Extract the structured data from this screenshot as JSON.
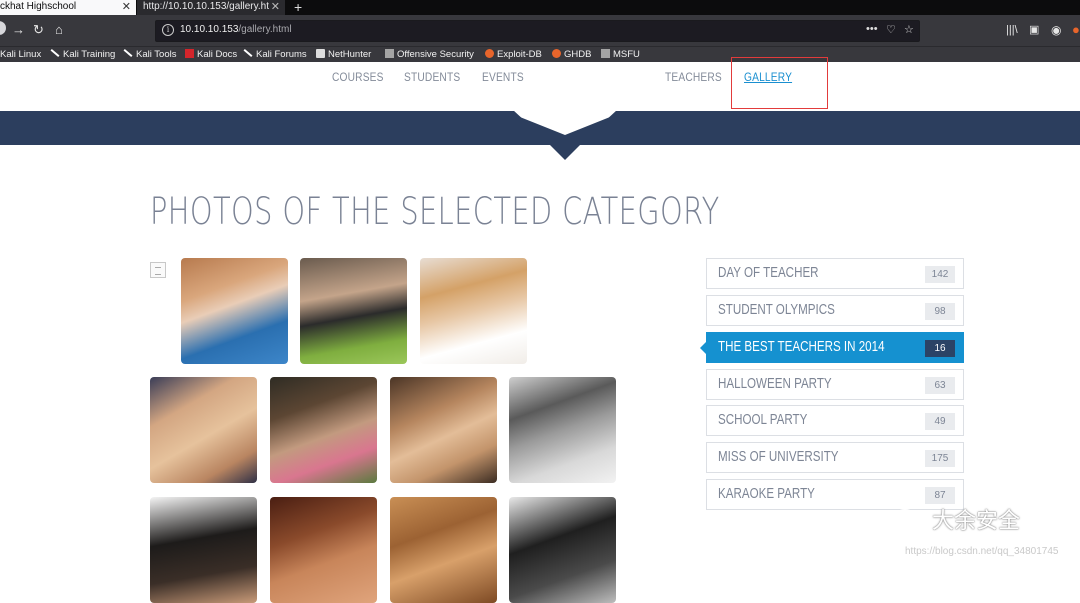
{
  "browser": {
    "tabs": [
      {
        "title": "ckhat Highschool",
        "close": "✕"
      },
      {
        "title": "http://10.10.10.153/gallery.ht",
        "close": "✕"
      }
    ],
    "new_tab": "+",
    "address": {
      "host": "10.10.10.153",
      "path": "/gallery.html"
    },
    "bookmarks": [
      {
        "label": "Kali Linux",
        "icon": "kali-dragon-icon"
      },
      {
        "label": "Kali Training",
        "icon": "kali-dragon-icon"
      },
      {
        "label": "Kali Tools",
        "icon": "kali-dragon-icon"
      },
      {
        "label": "Kali Docs",
        "icon": "kali-docs-icon"
      },
      {
        "label": "Kali Forums",
        "icon": "kali-dragon-icon"
      },
      {
        "label": "NetHunter",
        "icon": "nethunter-icon"
      },
      {
        "label": "Offensive Security",
        "icon": "offsec-icon"
      },
      {
        "label": "Exploit-DB",
        "icon": "exploitdb-icon"
      },
      {
        "label": "GHDB",
        "icon": "ghdb-icon"
      },
      {
        "label": "MSFU",
        "icon": "msfu-icon"
      }
    ]
  },
  "site_nav": {
    "items": [
      {
        "label": "COURSES"
      },
      {
        "label": "STUDENTS"
      },
      {
        "label": "EVENTS"
      },
      {
        "label": "TEACHERS"
      },
      {
        "label": "GALLERY",
        "active": true
      }
    ]
  },
  "content": {
    "title": "PHOTOS OF THE SELECTED CATEGORY"
  },
  "categories": [
    {
      "label": "DAY OF TEACHER",
      "count": "142"
    },
    {
      "label": "STUDENT OLYMPICS",
      "count": "98"
    },
    {
      "label": "THE BEST TEACHERS IN 2014",
      "count": "16",
      "active": true
    },
    {
      "label": "HALLOWEEN PARTY",
      "count": "63"
    },
    {
      "label": "SCHOOL PARTY",
      "count": "49"
    },
    {
      "label": "MISS OF UNIVERSITY",
      "count": "175"
    },
    {
      "label": "KARAOKE PARTY",
      "count": "87"
    }
  ],
  "watermark": {
    "text": "大余安全",
    "credit": "https://blog.csdn.net/qq_34801745"
  },
  "colors": {
    "accent": "#1591d0",
    "band": "#2c3e5e",
    "highlight": "#e23b3b"
  }
}
